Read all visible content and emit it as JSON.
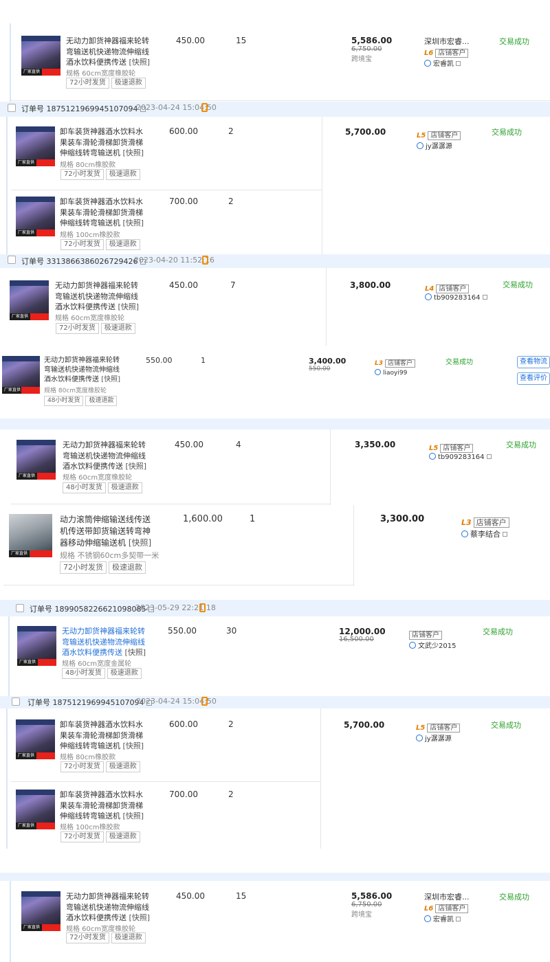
{
  "common": {
    "snapshot": "[快照]",
    "ship72": "72小时发货",
    "ship48": "48小时发货",
    "refund": "极速退款",
    "status": "交易成功",
    "store_customer": "店铺客户",
    "factory_label": "厂家直供"
  },
  "colors": {
    "header_bg": "#eaf3fd",
    "status_green": "#2ca02c",
    "level_orange": "#e17d00",
    "link_blue": "#1e6fd9"
  },
  "card1": {
    "title": "无动力卸货神器福来轮转弯输送机快递物流伸缩线酒水饮料便携传送",
    "spec": "规格 60cm宽度橡胶轮",
    "price": "450.00",
    "qty": "15",
    "total": "5,586.00",
    "orig": "6,750.00",
    "note": "跨境宝",
    "shop": "深圳市宏睿...",
    "level": "L6",
    "buyer": "宏睿凯"
  },
  "card2": {
    "order_no": "订单号 1875121969945107094",
    "order_time": "2023-04-24 15:04:50",
    "item1": {
      "title": "卸车装货神器酒水饮料水果装车滑轮滑梯卸货滑梯伸缩线转弯输送机",
      "spec": "规格 80cm橡胶款",
      "price": "600.00",
      "qty": "2"
    },
    "item2": {
      "title": "卸车装货神器酒水饮料水果装车滑轮滑梯卸货滑梯伸缩线转弯输送机",
      "spec": "规格 100cm橡胶款",
      "price": "700.00",
      "qty": "2"
    },
    "total": "5,700.00",
    "level": "L5",
    "buyer": "jy潺潺源"
  },
  "card3": {
    "order_no": "订单号 3313866386026729426",
    "order_time": "2023-04-20 11:52:16",
    "title": "无动力卸货神器福来轮转弯输送机快递物流伸缩线酒水饮料便携传送",
    "spec": "规格 60cm宽度橡胶轮",
    "price": "450.00",
    "qty": "7",
    "total": "3,800.00",
    "level": "L4",
    "buyer": "tb909283164"
  },
  "card4": {
    "title": "无动力卸货神器福来轮转弯输送机快递物流伸缩线酒水饮料便携传送",
    "spec": "规格 80cm宽度橡胶轮",
    "price": "550.00",
    "qty": "1",
    "total": "3,400.00",
    "orig": "550.00",
    "level": "L3",
    "buyer": "liaoyi99",
    "btn_logistics": "查看物流",
    "btn_review": "查看评价"
  },
  "card5": {
    "title": "无动力卸货神器福来轮转弯输送机快递物流伸缩线酒水饮料便携传送",
    "spec": "规格 60cm宽度橡胶轮",
    "price": "450.00",
    "qty": "4",
    "total": "3,350.00",
    "level": "L5",
    "buyer": "tb909283164"
  },
  "card6": {
    "title": "动力滚筒伸缩输送线传送机传送带卸货输送转弯神器移动伸缩输送机",
    "spec": "规格 不锈钢60cm多契带一米",
    "price": "1,600.00",
    "qty": "1",
    "total": "3,300.00",
    "level": "L3",
    "buyer": "蔡李结合"
  },
  "card7": {
    "order_no": "订单号 1899058226621098085",
    "order_time": "2023-05-29 22:21:18",
    "title": "无动力卸货神器福来轮转弯输送机快递物流伸缩线酒水饮料便携传送",
    "spec": "规格 60cm宽度金属轮",
    "price": "550.00",
    "qty": "30",
    "total": "12,000.00",
    "orig": "16,500.00",
    "buyer": "文武少2015"
  }
}
